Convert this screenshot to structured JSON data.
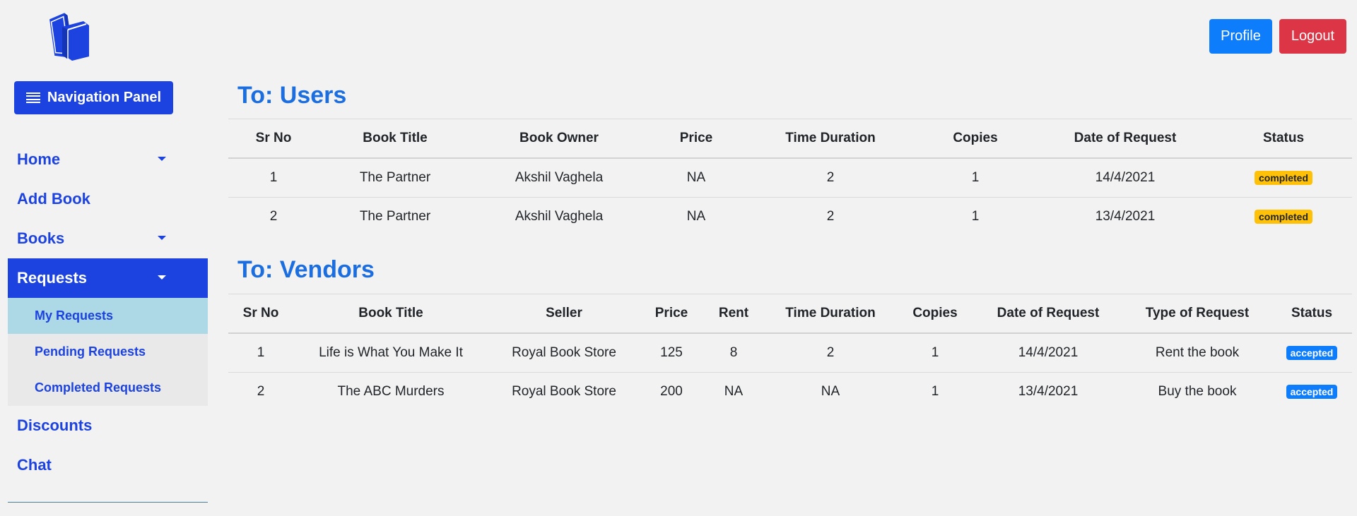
{
  "sidebar": {
    "logo_icon": "books-icon",
    "nav_panel_label": "Navigation Panel",
    "items": [
      {
        "label": "Home",
        "has_dropdown": true
      },
      {
        "label": "Add Book",
        "has_dropdown": false
      },
      {
        "label": "Books",
        "has_dropdown": true
      },
      {
        "label": "Requests",
        "has_dropdown": true,
        "active": true
      },
      {
        "label": "Discounts",
        "has_dropdown": false
      },
      {
        "label": "Chat",
        "has_dropdown": false
      }
    ],
    "requests_submenu": [
      {
        "label": "My Requests",
        "selected": true
      },
      {
        "label": "Pending Requests"
      },
      {
        "label": "Completed Requests"
      }
    ]
  },
  "header": {
    "profile_label": "Profile",
    "logout_label": "Logout"
  },
  "users_section": {
    "title": "To: Users",
    "columns": [
      "Sr No",
      "Book Title",
      "Book Owner",
      "Price",
      "Time Duration",
      "Copies",
      "Date of Request",
      "Status"
    ],
    "rows": [
      {
        "sr": "1",
        "title": "The Partner",
        "owner": "Akshil Vaghela",
        "price": "NA",
        "duration": "2",
        "copies": "1",
        "date": "14/4/2021",
        "status": "completed"
      },
      {
        "sr": "2",
        "title": "The Partner",
        "owner": "Akshil Vaghela",
        "price": "NA",
        "duration": "2",
        "copies": "1",
        "date": "13/4/2021",
        "status": "completed"
      }
    ]
  },
  "vendors_section": {
    "title": "To: Vendors",
    "columns": [
      "Sr No",
      "Book Title",
      "Seller",
      "Price",
      "Rent",
      "Time Duration",
      "Copies",
      "Date of Request",
      "Type of Request",
      "Status"
    ],
    "rows": [
      {
        "sr": "1",
        "title": "Life is What You Make It",
        "seller": "Royal Book Store",
        "price": "125",
        "rent": "8",
        "duration": "2",
        "copies": "1",
        "date": "14/4/2021",
        "type": "Rent the book",
        "status": "accepted"
      },
      {
        "sr": "2",
        "title": "The ABC Murders",
        "seller": "Royal Book Store",
        "price": "200",
        "rent": "NA",
        "duration": "NA",
        "copies": "1",
        "date": "13/4/2021",
        "type": "Buy the book",
        "status": "accepted"
      }
    ]
  },
  "colors": {
    "primary": "#1c43e0",
    "title_blue": "#1b6ee0",
    "profile_btn": "#0d7dfc",
    "logout_btn": "#dc3545",
    "completed_badge": "#ffc107",
    "accepted_badge": "#0d7dfc",
    "submenu_selected": "#add8e6"
  }
}
